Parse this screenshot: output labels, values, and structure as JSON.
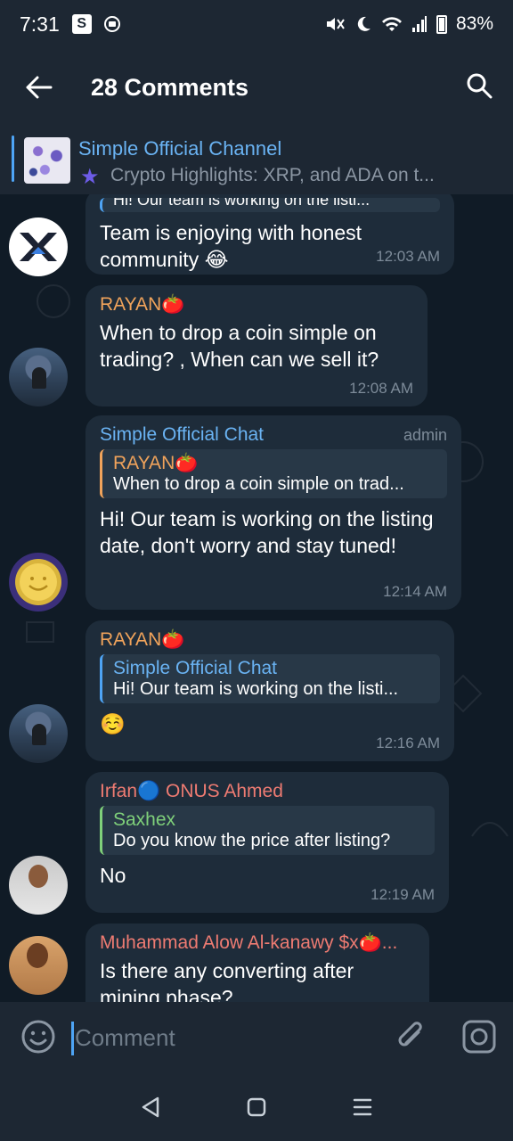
{
  "status_bar": {
    "time": "7:31",
    "s_icon": "S",
    "battery": "83%"
  },
  "header": {
    "title": "28 Comments"
  },
  "pinned": {
    "title": "Simple Official Channel",
    "text": "Crypto Highlights: XRP, and ADA on t..."
  },
  "messages": [
    {
      "quote_text": "Hi! Our team is working on the listi...",
      "text": "Team is enjoying with honest community 😂",
      "time": "12:03 AM"
    },
    {
      "sender": "RAYAN🍅",
      "text": "When to drop a coin simple on trading? , When can we sell it?",
      "time": "12:08 AM"
    },
    {
      "sender": "Simple Official Chat",
      "badge": "admin",
      "reply_name": "RAYAN🍅",
      "reply_text": "When to drop a coin simple on trad...",
      "text": "Hi! Our team is working on the listing date, don't worry and stay tuned!",
      "time": "12:14 AM"
    },
    {
      "sender": "RAYAN🍅",
      "reply_name": "Simple Official Chat",
      "reply_text": "Hi! Our team is working on the listi...",
      "text": "☺️",
      "time": "12:16 AM"
    },
    {
      "sender": "Irfan🔵 ONUS Ahmed",
      "reply_name": "Saxhex",
      "reply_text": "Do you know the price after listing?",
      "text": "No",
      "time": "12:19 AM"
    },
    {
      "sender": "Muhammad Alow Al-kanawy $x🍅...",
      "text": "Is there any converting after mining phase?"
    }
  ],
  "input": {
    "placeholder": "Comment"
  },
  "colors": {
    "accent": "#4ea4f5",
    "rayan": "#f0a35b",
    "simple_chat": "#6ab3f3",
    "irfan": "#ee7b72",
    "saxhex": "#7fd07a",
    "muhammad": "#ee7b72"
  },
  "icons": [
    "back-arrow-icon",
    "search-icon",
    "star-icon",
    "emoji-icon",
    "paperclip-icon",
    "camera-icon",
    "nav-back-icon",
    "nav-home-icon",
    "nav-menu-icon"
  ]
}
